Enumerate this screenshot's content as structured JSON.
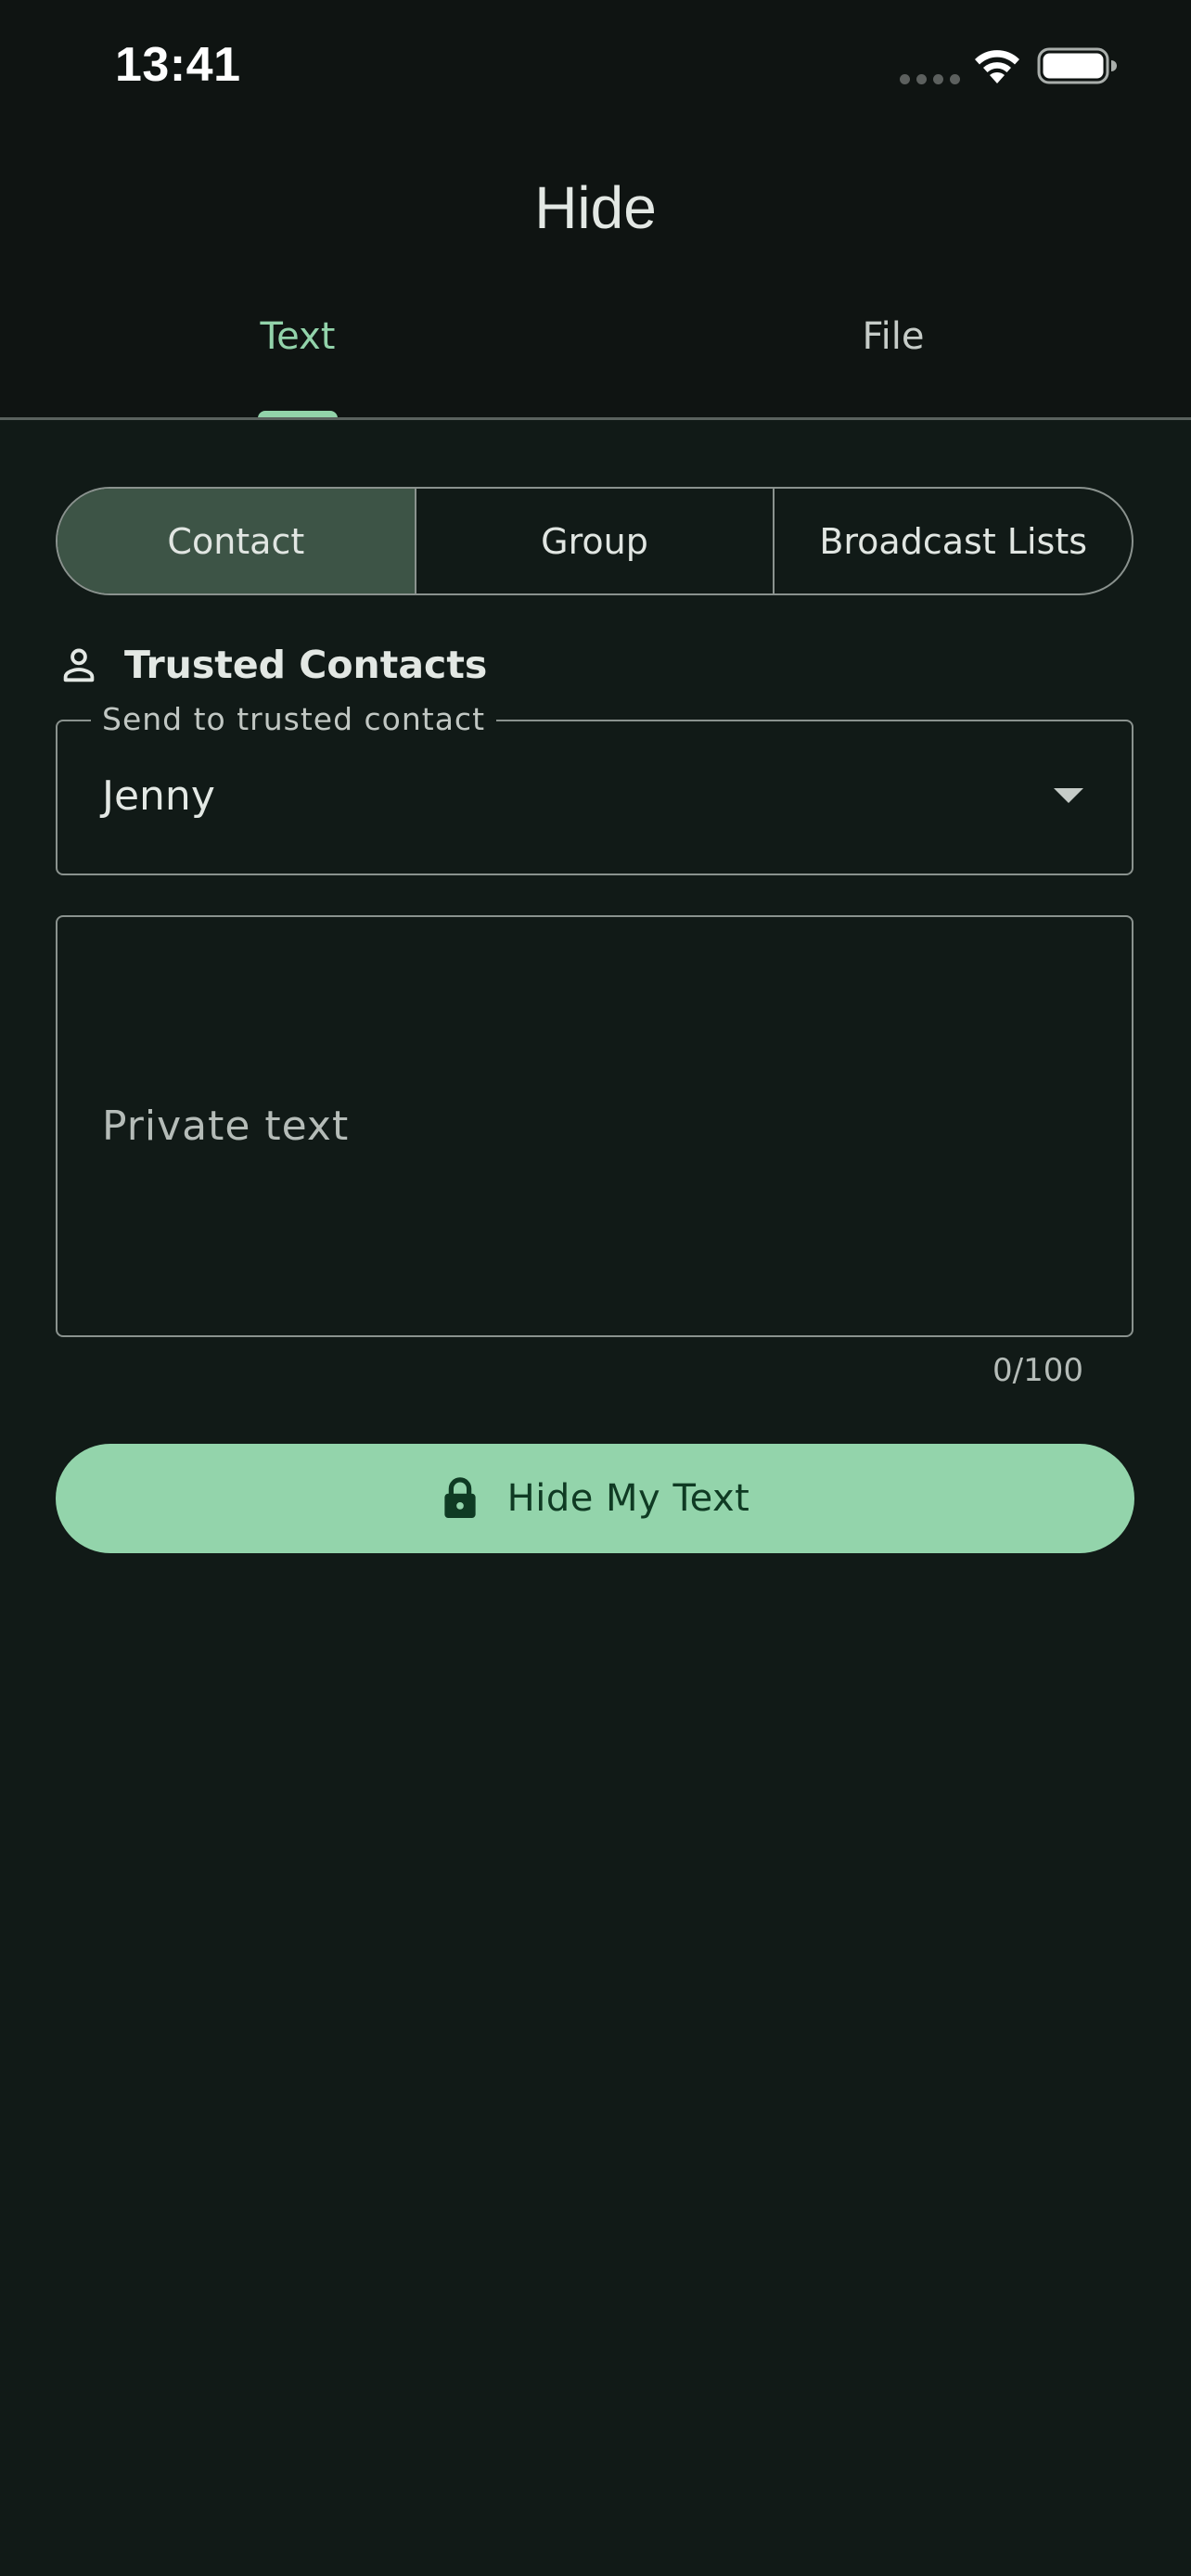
{
  "status_bar": {
    "time": "13:41",
    "icons": [
      "signal-icon",
      "wifi-icon",
      "battery-icon"
    ]
  },
  "app_bar": {
    "title": "Hide",
    "tabs": [
      {
        "label": "Text",
        "selected": true
      },
      {
        "label": "File",
        "selected": false
      }
    ]
  },
  "recipient_type": {
    "options": [
      "Contact",
      "Group",
      "Broadcast Lists"
    ],
    "selected": "Contact"
  },
  "trusted_contacts": {
    "icon": "person-icon",
    "title": "Trusted Contacts",
    "field_label": "Send to trusted contact",
    "selected_value": "Jenny"
  },
  "private_text": {
    "placeholder": "Private text",
    "counter": "0/100"
  },
  "action": {
    "icon": "lock-icon",
    "label": "Hide My Text"
  },
  "colors": {
    "background": "#111a17",
    "accent": "#93d4ab",
    "selected_segment": "#3d5446",
    "outline": "#8a928e"
  }
}
